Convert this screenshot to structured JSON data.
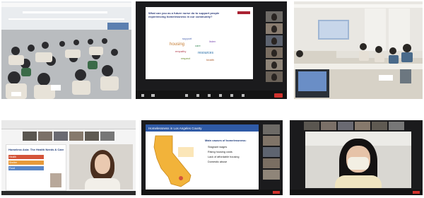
{
  "tiles": {
    "zoom_question": {
      "question_text": "What can you as a future nurse do to support people experiencing homelessness in our community?",
      "wordcloud": [
        "support",
        "housing",
        "care",
        "listen",
        "empathy",
        "resources",
        "respect",
        "health"
      ]
    },
    "presentation_left": {
      "slide_title": "Homeless Asia: The Health Needs & Care",
      "row_labels": [
        "Health",
        "Shelter",
        "Food"
      ]
    },
    "presentation_middle": {
      "slide_title": "Homelessness in Los Angeles County",
      "bullet_heading": "Main causes of homelessness:",
      "bullets": [
        "Stagnant wages",
        "Rising housing costs",
        "Lack of affordable housing",
        "Domestic abuse"
      ]
    }
  }
}
